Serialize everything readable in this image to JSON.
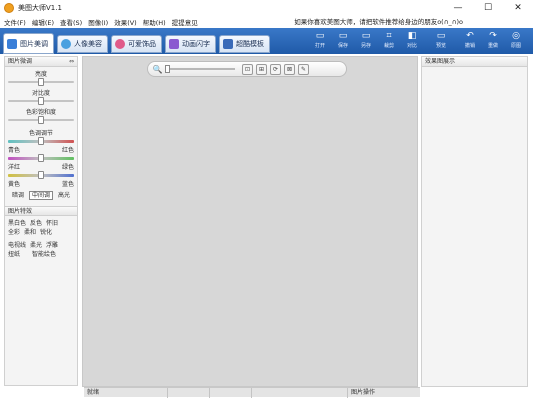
{
  "window": {
    "title": "美图大师V1.1",
    "controls": [
      "—",
      "☐",
      "✕"
    ]
  },
  "menu": {
    "items": [
      "文件(F)",
      "编辑(E)",
      "查看(S)",
      "图像(I)",
      "效果(V)",
      "帮助(H)",
      "提提意见"
    ],
    "tip": "如果你喜欢美图大师，请把软件推荐给身边的朋友o(∩_∩)o"
  },
  "tabs": [
    {
      "label": "图片美调",
      "color": "#3a7fd8"
    },
    {
      "label": "人像美容",
      "color": "#4aa0e0"
    },
    {
      "label": "可爱饰品",
      "color": "#e05a8a"
    },
    {
      "label": "动画闪字",
      "color": "#8a5ad0"
    },
    {
      "label": "超酷模板",
      "color": "#3a6ab8"
    }
  ],
  "toolbar": {
    "buttons": [
      {
        "label": "打开",
        "icon": "open-icon",
        "glyph": "▭"
      },
      {
        "label": "保存",
        "icon": "save-icon",
        "glyph": "▭"
      },
      {
        "label": "另存",
        "icon": "save-as-icon",
        "glyph": "▭"
      },
      {
        "label": "裁剪",
        "icon": "crop-icon",
        "glyph": "⌗"
      },
      {
        "label": "对比",
        "icon": "compare-icon",
        "glyph": "◧"
      },
      {
        "label": "预览",
        "icon": "preview-icon",
        "glyph": "▭"
      },
      {
        "label": "撤销",
        "icon": "undo-icon",
        "glyph": "↶"
      },
      {
        "label": "重做",
        "icon": "redo-icon",
        "glyph": "↷"
      },
      {
        "label": "原图",
        "icon": "original-icon",
        "glyph": "◎"
      }
    ]
  },
  "adjust_panel": {
    "title": "图片微调",
    "sliders": [
      {
        "label": "亮度",
        "value": 0.5
      },
      {
        "label": "对比度",
        "value": 0.5
      },
      {
        "label": "色彩饱和度",
        "value": 0.5
      }
    ],
    "tone_title": "色调调节",
    "tone_sliders": [
      {
        "left": "青色",
        "right": "红色",
        "value": 0.5,
        "gradient": "linear-gradient(to right,#5fc0c0,#c0c0c0,#d05050)"
      },
      {
        "left": "洋红",
        "right": "绿色",
        "value": 0.5,
        "gradient": "linear-gradient(to right,#c050c0,#c0c0c0,#60c060)"
      },
      {
        "left": "黄色",
        "right": "蓝色",
        "value": 0.5,
        "gradient": "linear-gradient(to right,#d0c040,#c0c0c0,#5070d0)"
      }
    ],
    "tone_buttons": [
      {
        "label": "暗调",
        "active": false
      },
      {
        "label": "中间调",
        "active": true
      },
      {
        "label": "高光",
        "active": false
      }
    ]
  },
  "effects_panel": {
    "title": "图片特效",
    "rows": [
      [
        "黑白色",
        "反色",
        "怀旧"
      ],
      [
        "全彩",
        "柔和",
        "锐化"
      ],
      null,
      [
        "电视线",
        "柔光",
        "浮雕"
      ],
      [
        "扭纸",
        "",
        "智能绘色"
      ]
    ]
  },
  "canvas": {
    "zoom": 0.0,
    "buttons": [
      {
        "icon": "zoom-in-icon",
        "glyph": "⊡"
      },
      {
        "icon": "actual-size-icon",
        "glyph": "⊞"
      },
      {
        "icon": "rotate-icon",
        "glyph": "⟳"
      },
      {
        "icon": "fit-icon",
        "glyph": "⊠"
      },
      {
        "icon": "brush-icon",
        "glyph": "✎"
      }
    ]
  },
  "right_panel": {
    "title": "效果图展示"
  },
  "status": {
    "ready": "就绪",
    "right": "图片操作"
  }
}
